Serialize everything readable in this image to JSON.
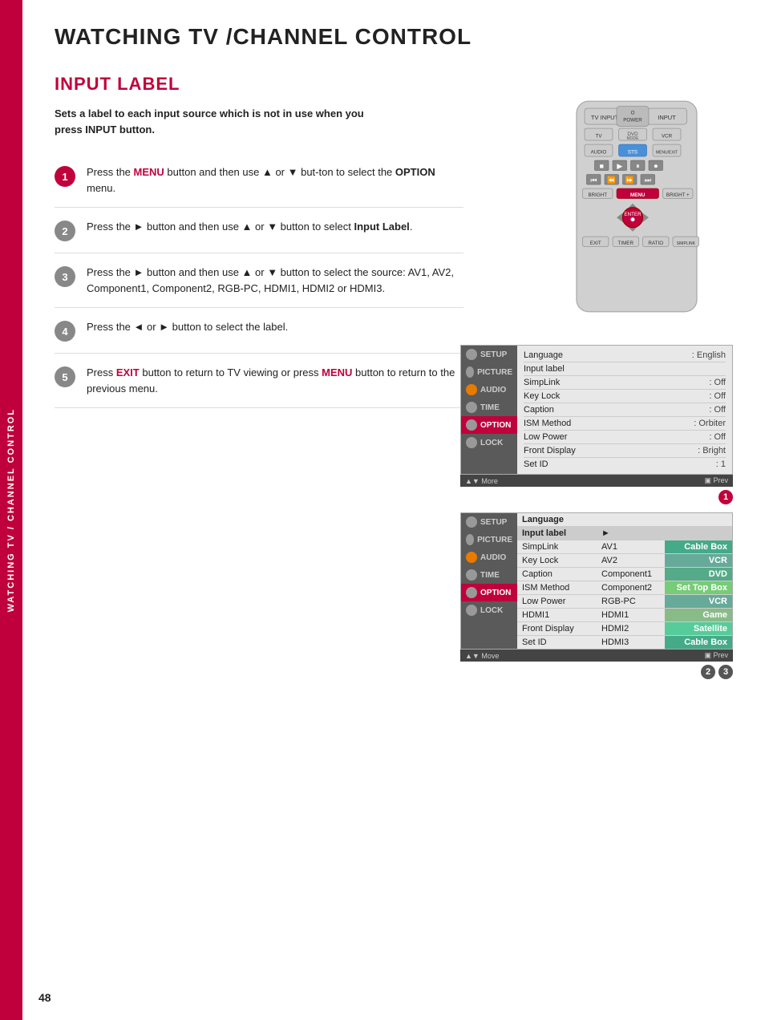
{
  "page": {
    "title": "WATCHING TV /CHANNEL CONTROL",
    "number": "48",
    "sidebar_label": "WATCHING TV / CHANNEL CONTROL"
  },
  "section": {
    "title": "INPUT LABEL",
    "description_line1": "Sets a label to each input source which is not in use when you",
    "description_line2": "press INPUT button."
  },
  "steps": [
    {
      "number": "1",
      "text_parts": [
        {
          "type": "normal",
          "text": "Press the "
        },
        {
          "type": "red_bold",
          "text": "MENU"
        },
        {
          "type": "normal",
          "text": " button and then use ▲ or ▼ but-ton to select the "
        },
        {
          "type": "bold",
          "text": "OPTION"
        },
        {
          "type": "normal",
          "text": " menu."
        }
      ]
    },
    {
      "number": "2",
      "text_parts": [
        {
          "type": "normal",
          "text": "Press the ► button and then use ▲ or ▼ button to select "
        },
        {
          "type": "bold",
          "text": "Input Label"
        },
        {
          "type": "normal",
          "text": "."
        }
      ]
    },
    {
      "number": "3",
      "text_parts": [
        {
          "type": "normal",
          "text": "Press the ► button and then use ▲ or ▼ button to select the source: AV1, AV2, Component1, Component2, RGB-PC, HDMI1, HDMI2 or HDMI3."
        }
      ]
    },
    {
      "number": "4",
      "text_parts": [
        {
          "type": "normal",
          "text": "Press the ◄ or ► button to select the label."
        }
      ]
    },
    {
      "number": "5",
      "text_parts": [
        {
          "type": "normal",
          "text": "Press "
        },
        {
          "type": "red_bold",
          "text": "EXIT"
        },
        {
          "type": "normal",
          "text": " button to return to TV viewing or press "
        },
        {
          "type": "red_bold",
          "text": "MENU"
        },
        {
          "type": "normal",
          "text": " button to return to the previous menu."
        }
      ]
    }
  ],
  "menu1": {
    "left_items": [
      {
        "label": "SETUP",
        "icon": "gray",
        "active": false
      },
      {
        "label": "PICTURE",
        "icon": "gray",
        "active": false
      },
      {
        "label": "AUDIO",
        "icon": "orange",
        "active": false
      },
      {
        "label": "TIME",
        "icon": "gray",
        "active": false
      },
      {
        "label": "OPTION",
        "icon": "gray",
        "active": true,
        "highlight": true
      },
      {
        "label": "LOCK",
        "icon": "gray",
        "active": false
      }
    ],
    "right_rows": [
      {
        "label": "Language",
        "value": ": English"
      },
      {
        "label": "Input label",
        "value": ""
      },
      {
        "label": "SimpLink",
        "value": ": Off"
      },
      {
        "label": "Key Lock",
        "value": ": Off"
      },
      {
        "label": "Caption",
        "value": ": Off"
      },
      {
        "label": "ISM Method",
        "value": ": Orbiter"
      },
      {
        "label": "Low Power",
        "value": ": Off"
      },
      {
        "label": "Front Display",
        "value": ": Bright"
      },
      {
        "label": "Set ID",
        "value": ": 1"
      }
    ],
    "bottom_bar": "▲▼ More    Prev",
    "marker": "1"
  },
  "menu2": {
    "left_items": [
      {
        "label": "SETUP",
        "icon": "gray",
        "active": false
      },
      {
        "label": "PICTURE",
        "icon": "gray",
        "active": false
      },
      {
        "label": "AUDIO",
        "icon": "orange",
        "active": false
      },
      {
        "label": "TIME",
        "icon": "gray",
        "active": false
      },
      {
        "label": "OPTION",
        "icon": "gray",
        "active": true,
        "highlight": true
      },
      {
        "label": "LOCK",
        "icon": "gray",
        "active": false
      }
    ],
    "right_rows": [
      {
        "label": "Language",
        "value": ""
      },
      {
        "label": "Input label",
        "has_arrow": true
      },
      {
        "label": "SimpLink",
        "value": ""
      },
      {
        "label": "Key Lock",
        "value": ""
      },
      {
        "label": "Caption",
        "value": ""
      },
      {
        "label": "ISM Method",
        "value": ""
      },
      {
        "label": "Low Power",
        "value": ""
      },
      {
        "label": "Front Display",
        "value": ""
      },
      {
        "label": "Set ID",
        "value": ""
      }
    ],
    "sub_columns": [
      {
        "source": "AV1",
        "label": "Cable Box",
        "type": "cable"
      },
      {
        "source": "AV2",
        "label": "VCR",
        "type": "vcr"
      },
      {
        "source": "Component1",
        "label": "DVD",
        "type": "dvd"
      },
      {
        "source": "Component2",
        "label": "Set Top Box",
        "type": "settopbox"
      },
      {
        "source": "RGB-PC",
        "label": "VCR",
        "type": "vcr"
      },
      {
        "source": "HDMI1",
        "label": "Game",
        "type": "game"
      },
      {
        "source": "HDMI2",
        "label": "Satellite",
        "type": "satellite"
      },
      {
        "source": "HDMI3",
        "label": "Cable Box",
        "type": "cable"
      }
    ],
    "bottom_bar": "▲▼ Move    Prev",
    "markers": [
      "2",
      "3"
    ]
  }
}
